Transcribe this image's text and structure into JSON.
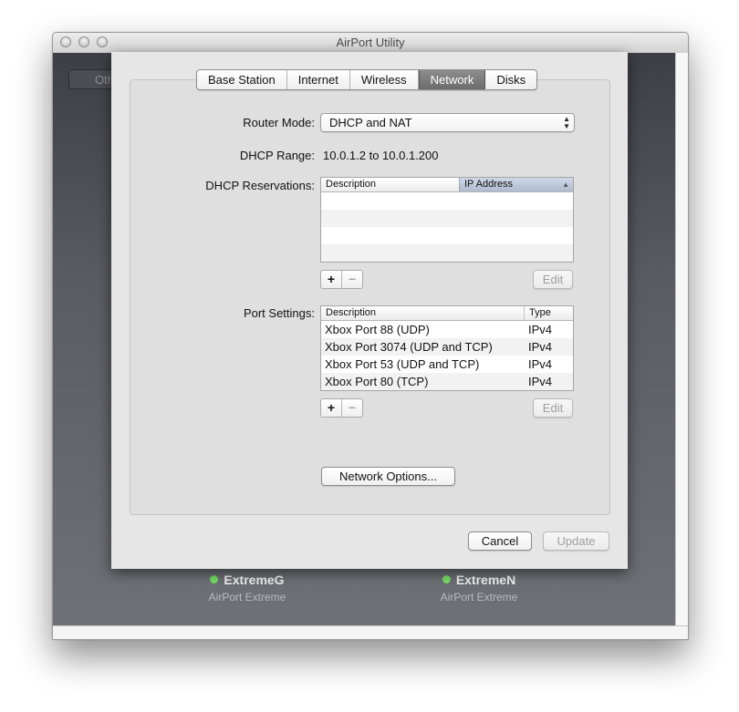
{
  "window": {
    "title": "AirPort Utility"
  },
  "background": {
    "other_button_label": "Other Wi-Fi Devices",
    "devices": [
      {
        "name": "ExtremeG",
        "model": "AirPort Extreme",
        "status_color": "#77dd66"
      },
      {
        "name": "ExtremeN",
        "model": "AirPort Extreme",
        "status_color": "#77dd66"
      }
    ]
  },
  "tabs": [
    {
      "label": "Base Station",
      "active": false
    },
    {
      "label": "Internet",
      "active": false
    },
    {
      "label": "Wireless",
      "active": false
    },
    {
      "label": "Network",
      "active": true
    },
    {
      "label": "Disks",
      "active": false
    }
  ],
  "network": {
    "router_mode_label": "Router Mode:",
    "router_mode_value": "DHCP and NAT",
    "dhcp_range_label": "DHCP Range:",
    "dhcp_range_value": "10.0.1.2 to 10.0.1.200",
    "dhcp_reservations_label": "DHCP Reservations:",
    "reservations_table": {
      "columns": [
        "Description",
        "IP Address"
      ],
      "rows": []
    },
    "port_settings_label": "Port Settings:",
    "port_table": {
      "columns": [
        "Description",
        "Type"
      ],
      "rows": [
        {
          "description": "Xbox Port 88 (UDP)",
          "type": "IPv4"
        },
        {
          "description": "Xbox Port 3074 (UDP and TCP)",
          "type": "IPv4"
        },
        {
          "description": "Xbox Port 53 (UDP and TCP)",
          "type": "IPv4"
        },
        {
          "description": "Xbox Port 80 (TCP)",
          "type": "IPv4"
        }
      ]
    },
    "add_symbol": "+",
    "remove_symbol": "−",
    "edit_label": "Edit",
    "network_options_label": "Network Options..."
  },
  "footer": {
    "cancel_label": "Cancel",
    "update_label": "Update"
  }
}
